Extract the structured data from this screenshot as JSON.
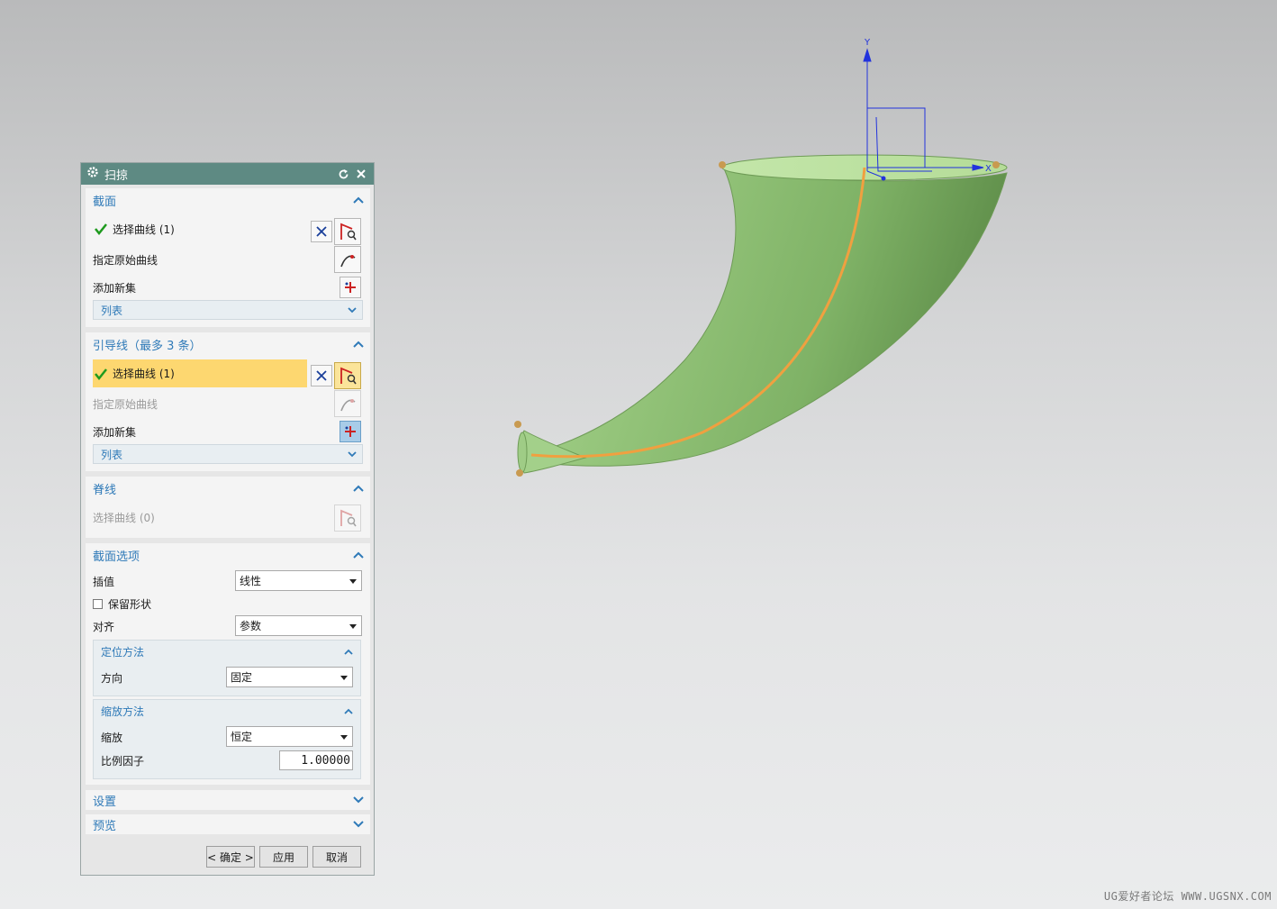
{
  "dialog": {
    "title": "扫掠",
    "section": {
      "title": "截面",
      "select_curve": "选择曲线 (1)",
      "specify_origin_curve": "指定原始曲线",
      "add_new_set": "添加新集",
      "list": "列表"
    },
    "guide": {
      "title": "引导线（最多 3 条）",
      "select_curve": "选择曲线 (1)",
      "specify_origin_curve": "指定原始曲线",
      "add_new_set": "添加新集",
      "list": "列表"
    },
    "spine": {
      "title": "脊线",
      "select_curve": "选择曲线 (0)"
    },
    "section_options": {
      "title": "截面选项",
      "interpolation_label": "插值",
      "interpolation_value": "线性",
      "preserve_shape": "保留形状",
      "align_label": "对齐",
      "align_value": "参数",
      "orientation": {
        "title": "定位方法",
        "direction_label": "方向",
        "direction_value": "固定"
      },
      "scaling": {
        "title": "缩放方法",
        "scale_label": "缩放",
        "scale_value": "恒定",
        "factor_label": "比例因子",
        "factor_value": "1.00000"
      }
    },
    "settings": {
      "title": "设置"
    },
    "preview": {
      "title": "预览"
    },
    "buttons": {
      "ok": "< 确定 >",
      "apply": "应用",
      "cancel": "取消"
    }
  },
  "viewport": {
    "axis_y_label": "Y",
    "axis_x_label": "X",
    "surface_color": "#9bc87e",
    "curve_color": "#f0a040"
  },
  "watermark": "UG爱好者论坛 WWW.UGSNX.COM"
}
